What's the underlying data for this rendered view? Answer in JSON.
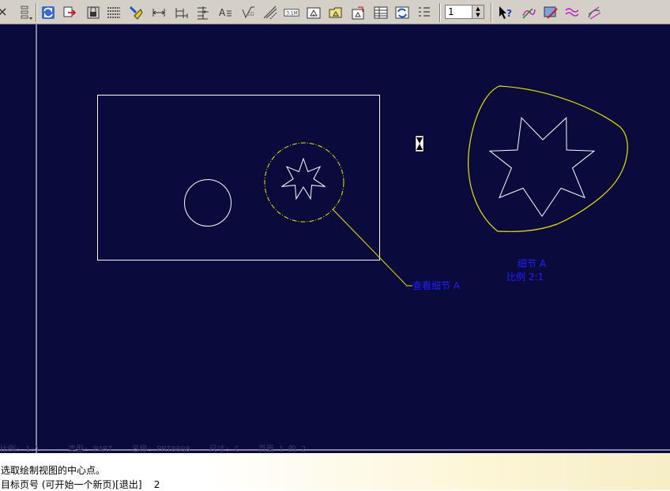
{
  "toolbar": {
    "icons": [
      "close-icon",
      "dropdown-menu-icon",
      "regenerate-icon",
      "move-item-icon",
      "lock-view-icon",
      "table-icon",
      "highlight-icon",
      "dimension-icon",
      "dimension-baseline-icon",
      "dimension-ordinate-icon",
      "note-icon",
      "surface-finish-icon",
      "geometric-tolerance-icon",
      "scale-text-icon",
      "view-icon",
      "folder-view-icon",
      "datum-icon",
      "table-grid-icon",
      "table-refresh-icon",
      "list-icon",
      "help-pointer-icon",
      "sketch-tool-icon",
      "paint-tool-icon",
      "wave-icon",
      "curve-tool-icon"
    ],
    "scale_value": "1"
  },
  "drawing": {
    "callout_label": "查看细节 A",
    "detail_title": "细节 A",
    "detail_scale": "比例 2:1",
    "colors": {
      "background": "#0a0a3c",
      "geometry": "#ffffff",
      "detail_boundary": "#ffff00",
      "annotation": "#0000ff"
    }
  },
  "status_bar": {
    "text": "比例: 1:1      类型: PART    名称: PRT0008    尺寸: C    页面 1 的 2"
  },
  "message_area": {
    "line1": "选取绘制视图的中心点。",
    "line2": "目标页号 (可开始一个新页)[退出]    2"
  }
}
